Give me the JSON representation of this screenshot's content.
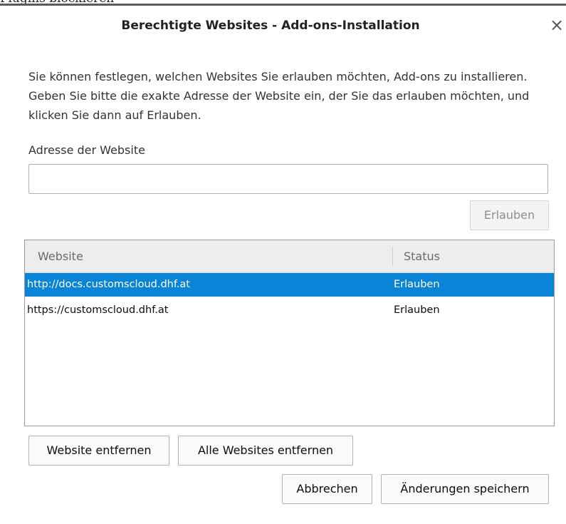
{
  "background": {
    "partial_text": "Plugins blockieren"
  },
  "dialog": {
    "title": "Berechtigte Websites - Add-ons-Installation",
    "close_symbol": "×",
    "description": "Sie können festlegen, welchen Websites Sie erlauben möchten, Add-ons zu installieren. Geben Sie bitte die exakte Adresse der Website ein, der Sie das erlauben möchten, und klicken Sie dann auf Erlauben.",
    "address_label": "Adresse der Website",
    "address_value": "",
    "allow_button": "Erlauben"
  },
  "table": {
    "columns": [
      "Website",
      "Status"
    ],
    "rows": [
      {
        "website": "http://docs.customscloud.dhf.at",
        "status": "Erlauben",
        "selected": true
      },
      {
        "website": "https://customscloud.dhf.at",
        "status": "Erlauben",
        "selected": false
      }
    ]
  },
  "buttons": {
    "remove_site": "Website entfernen",
    "remove_all": "Alle Websites entfernen",
    "cancel": "Abbrechen",
    "save": "Änderungen speichern"
  },
  "colors": {
    "selection": "#0a84d6",
    "header_bg": "#ededed"
  },
  "icons": {
    "close": "close-icon"
  }
}
